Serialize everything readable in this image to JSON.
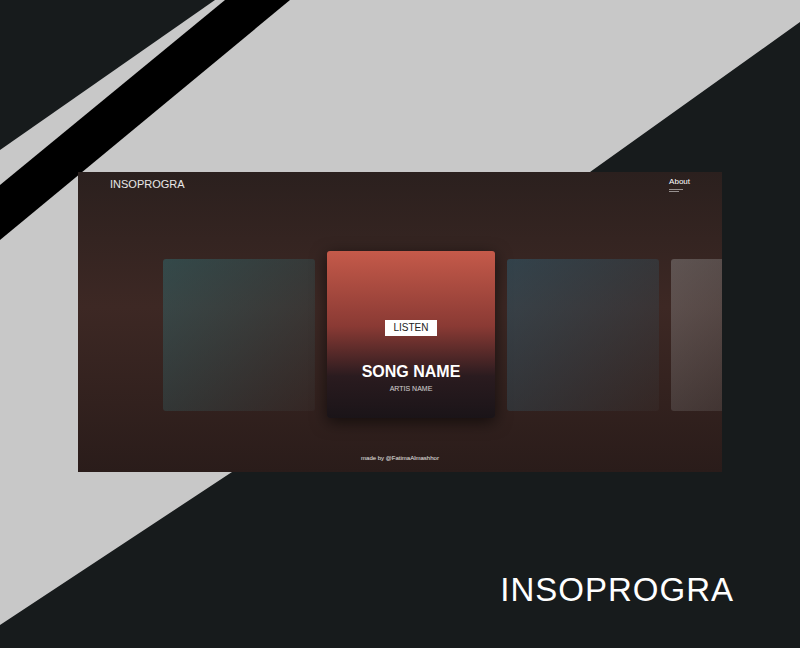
{
  "site": {
    "logo": "INSOPROGRA",
    "nav": [
      "About"
    ],
    "footer": "made by @FatimaAlmashhor"
  },
  "cards": [
    {
      "kind": "photo",
      "selected": false,
      "color": "#2f7f86"
    },
    {
      "kind": "featured",
      "selected": true,
      "color": "#c55a4a",
      "button": "LISTEN",
      "title": "SONG NAME",
      "artist": "ARTIS NAME"
    },
    {
      "kind": "photo",
      "selected": false,
      "color": "#2d6f8a"
    },
    {
      "kind": "photo",
      "selected": false,
      "color": "#9a9a9a"
    }
  ],
  "caption": "INSOPROGRA"
}
